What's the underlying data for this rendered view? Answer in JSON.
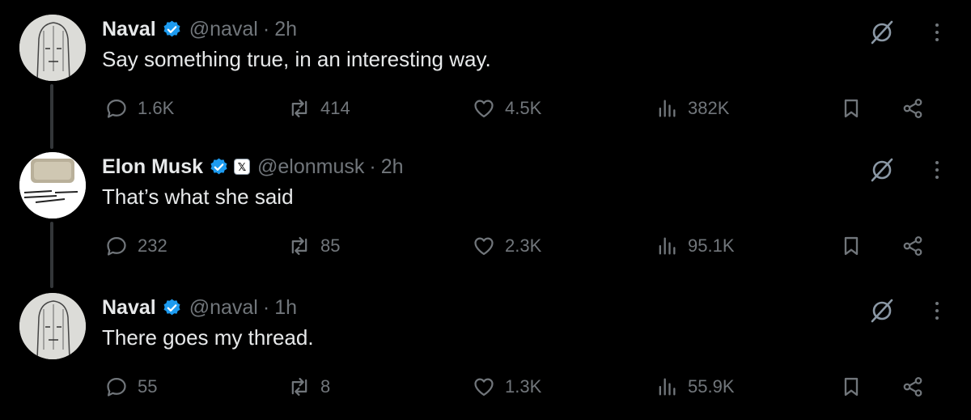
{
  "tweets": [
    {
      "name": "Naval",
      "handle": "@naval",
      "separator": "·",
      "time": "2h",
      "text": "Say something true, in an interesting way.",
      "replies": "1.6K",
      "reposts": "414",
      "likes": "4.5K",
      "views": "382K",
      "avatar": "naval-sketch-avatar"
    },
    {
      "name": "Elon Musk",
      "handle": "@elonmusk",
      "separator": "·",
      "time": "2h",
      "text": "That’s what she said",
      "replies": "232",
      "reposts": "85",
      "likes": "2.3K",
      "views": "95.1K",
      "avatar": "elon-avatar",
      "affiliate_badge": "𝕏"
    },
    {
      "name": "Naval",
      "handle": "@naval",
      "separator": "·",
      "time": "1h",
      "text": "There goes my thread.",
      "replies": "55",
      "reposts": "8",
      "likes": "1.3K",
      "views": "55.9K",
      "avatar": "naval-sketch-avatar"
    }
  ],
  "colors": {
    "background": "#000000",
    "text_primary": "#e7e9ea",
    "text_secondary": "#71767b",
    "verified": "#1d9bf0",
    "thread_line": "#333639"
  },
  "icons": [
    "reply-icon",
    "repost-icon",
    "like-icon",
    "views-icon",
    "bookmark-icon",
    "share-icon",
    "grok-icon",
    "more-icon",
    "verified-icon"
  ]
}
